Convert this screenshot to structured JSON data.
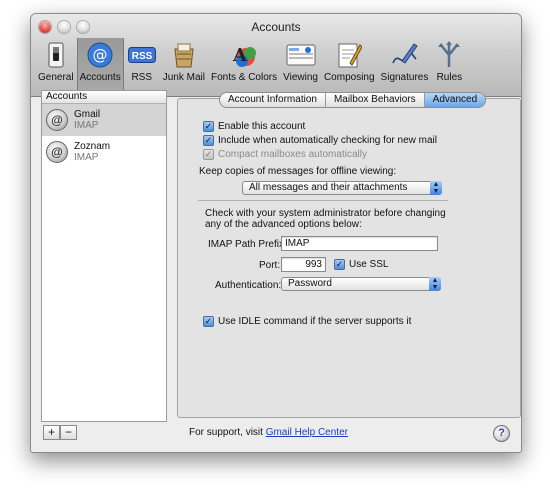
{
  "window": {
    "title": "Accounts"
  },
  "toolbar": {
    "items": [
      {
        "label": "General",
        "icon": "general-switch-icon"
      },
      {
        "label": "Accounts",
        "icon": "at-sign-icon"
      },
      {
        "label": "RSS",
        "icon": "rss-icon"
      },
      {
        "label": "Junk Mail",
        "icon": "junk-mail-icon"
      },
      {
        "label": "Fonts & Colors",
        "icon": "fonts-colors-icon"
      },
      {
        "label": "Viewing",
        "icon": "viewing-icon"
      },
      {
        "label": "Composing",
        "icon": "composing-icon"
      },
      {
        "label": "Signatures",
        "icon": "signatures-icon"
      },
      {
        "label": "Rules",
        "icon": "rules-icon"
      }
    ],
    "rss_badge": "RSS"
  },
  "sidebar": {
    "header": "Accounts",
    "accounts": [
      {
        "name": "Gmail",
        "type": "IMAP"
      },
      {
        "name": "Zoznam",
        "type": "IMAP"
      }
    ],
    "add_label": "+",
    "remove_label": "−"
  },
  "tabs": [
    "Account Information",
    "Mailbox Behaviors",
    "Advanced"
  ],
  "advanced": {
    "enable_account": "Enable this account",
    "include_checking": "Include when automatically checking for new mail",
    "compact_mailboxes": "Compact mailboxes automatically",
    "keep_copies_label": "Keep copies of messages for offline viewing:",
    "keep_copies_value": "All messages and their attachments",
    "admin_note_1": "Check with your system administrator before changing",
    "admin_note_2": "any of the advanced options below:",
    "imap_prefix_label": "IMAP Path Prefix:",
    "imap_prefix_value": "IMAP",
    "port_label": "Port:",
    "port_value": "993",
    "use_ssl": "Use SSL",
    "auth_label": "Authentication:",
    "auth_value": "Password",
    "use_idle": "Use IDLE command if the server supports it"
  },
  "footer": {
    "support_prefix": "For support, visit",
    "support_link": "Gmail Help Center",
    "help_label": "?"
  },
  "colors": {
    "accent": "#4c8ee0",
    "selection": "#d4d4d4"
  }
}
